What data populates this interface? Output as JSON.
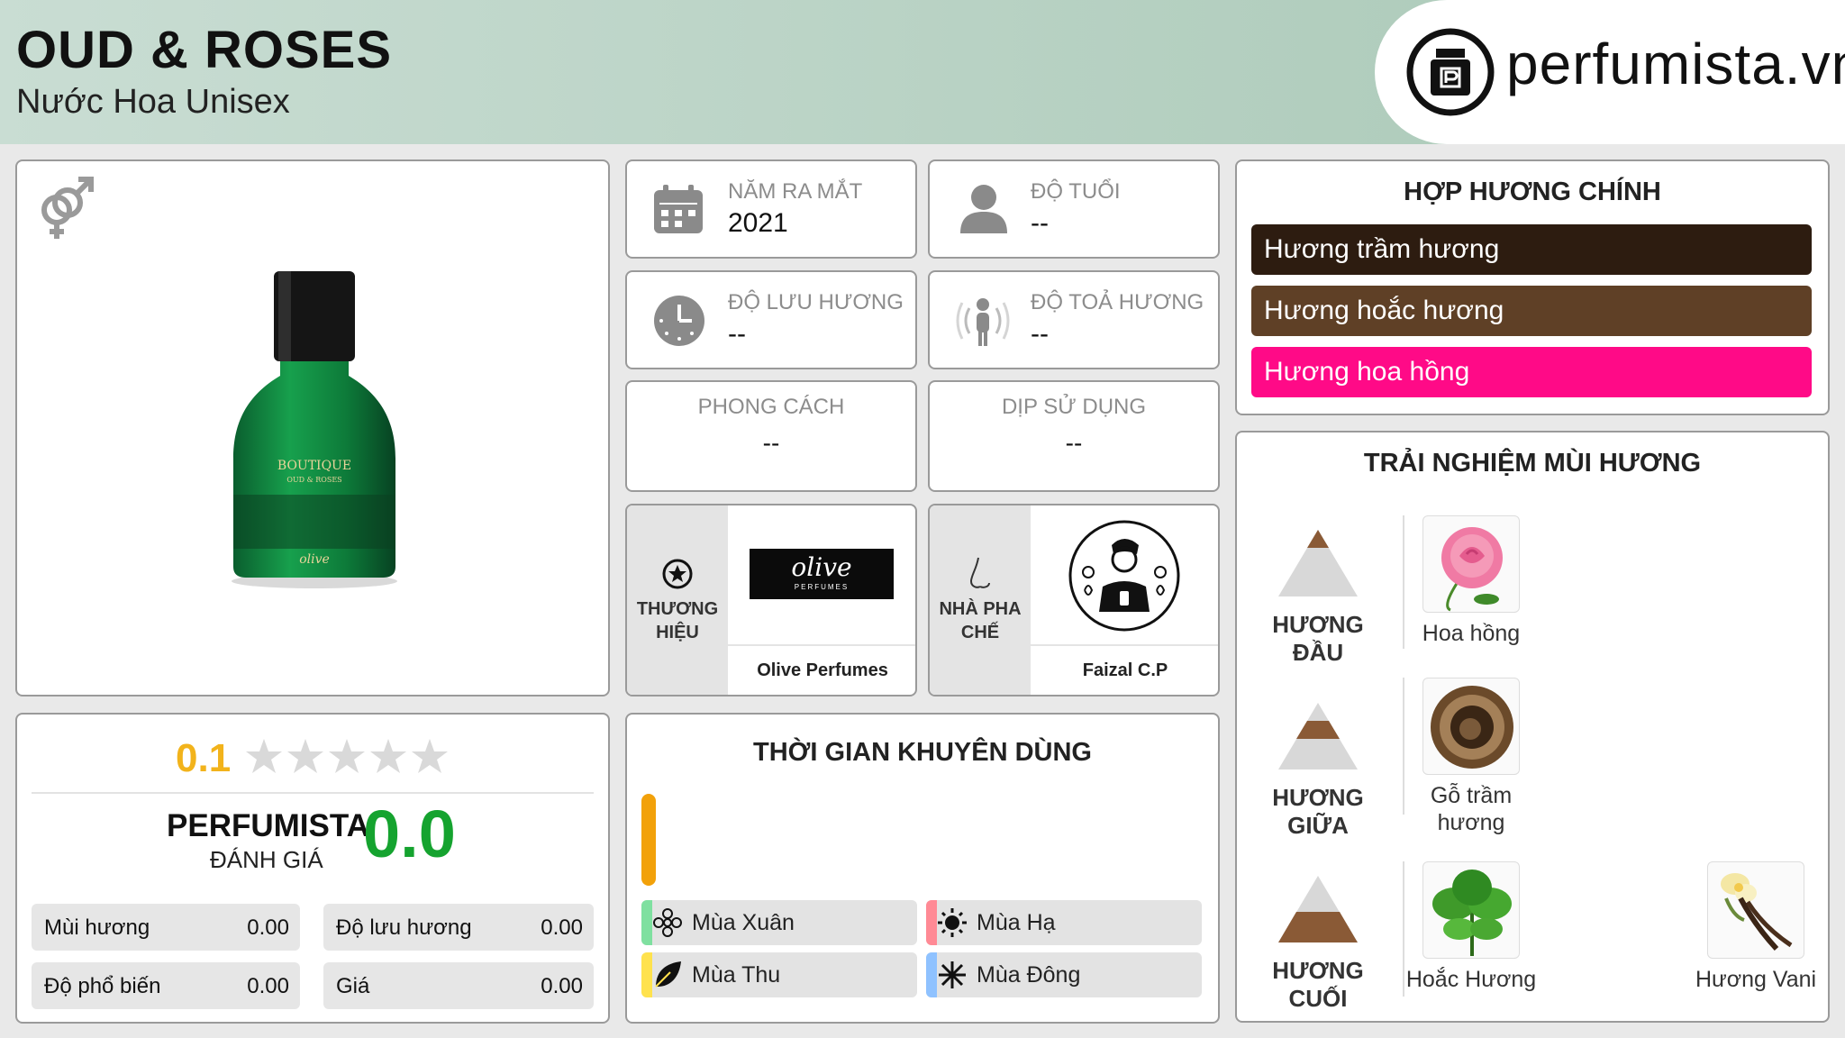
{
  "header": {
    "title": "OUD & ROSES",
    "subtitle": "Nước Hoa Unisex",
    "brand": "perfumista.vn"
  },
  "product": {
    "gender_icon": "unisex-gender-icon",
    "bottle_label_top": "BOUTIQUE",
    "bottle_label_sub": "OUD & ROSES",
    "bottle_brand": "olive"
  },
  "info": {
    "release_year": {
      "label": "NĂM RA MẮT",
      "value": "2021",
      "icon": "calendar-icon"
    },
    "age": {
      "label": "ĐỘ TUỔI",
      "value": "--",
      "icon": "person-icon"
    },
    "longevity": {
      "label": "ĐỘ LƯU HƯƠNG",
      "value": "--",
      "icon": "clock-icon"
    },
    "sillage": {
      "label": "ĐỘ TOẢ HƯƠNG",
      "value": "--",
      "icon": "sillage-icon"
    },
    "style": {
      "label": "PHONG CÁCH",
      "value": "--"
    },
    "occasion": {
      "label": "DỊP SỬ DỤNG",
      "value": "--"
    },
    "brand": {
      "label_line1": "THƯƠNG",
      "label_line2": "HIỆU",
      "name": "Olive Perfumes",
      "logo_text": "olive",
      "logo_sub": "PERFUMES"
    },
    "perfumer": {
      "label_line1": "NHÀ PHA",
      "label_line2": "CHẾ",
      "name": "Faizal C.P"
    }
  },
  "accords": {
    "title": "HỢP HƯƠNG CHÍNH",
    "items": [
      {
        "label": "Hương trầm hương",
        "color": "#2d1c10"
      },
      {
        "label": "Hương hoắc hương",
        "color": "#5f4026"
      },
      {
        "label": "Hương hoa hồng",
        "color": "#ff0a87"
      }
    ]
  },
  "notes": {
    "title": "TRẢI NGHIỆM MÙI HƯƠNG",
    "top": {
      "label": "HƯƠNG ĐẦU",
      "items": [
        "Hoa hồng"
      ]
    },
    "middle": {
      "label": "HƯƠNG GIỮA",
      "items": [
        "Gỗ trầm hương"
      ]
    },
    "base": {
      "label": "HƯƠNG CUỐI",
      "items": [
        "Hoắc Hương",
        "Hương Vani"
      ]
    }
  },
  "rating": {
    "user_score": "0.1",
    "stars_filled": 0,
    "stars_total": 5,
    "perfumista_label": "PERFUMISTA",
    "review_label": "ĐÁNH GIÁ",
    "perfumista_score": "0.0",
    "scores": [
      {
        "label": "Mùi hương",
        "value": "0.00"
      },
      {
        "label": "Độ lưu hương",
        "value": "0.00"
      },
      {
        "label": "Độ phổ biến",
        "value": "0.00"
      },
      {
        "label": "Giá",
        "value": "0.00"
      }
    ]
  },
  "usage": {
    "title": "THỜI GIAN KHUYÊN DÙNG",
    "day_night_bar_color": "#f2a10a",
    "seasons": [
      {
        "label": "Mùa Xuân",
        "color": "#7fe0a0",
        "icon": "flower-icon"
      },
      {
        "label": "Mùa Hạ",
        "color": "#ff8a95",
        "icon": "sun-icon"
      },
      {
        "label": "Mùa Thu",
        "color": "#ffe24d",
        "icon": "leaf-icon"
      },
      {
        "label": "Mùa Đông",
        "color": "#8fc2ff",
        "icon": "snowflake-icon"
      }
    ]
  }
}
